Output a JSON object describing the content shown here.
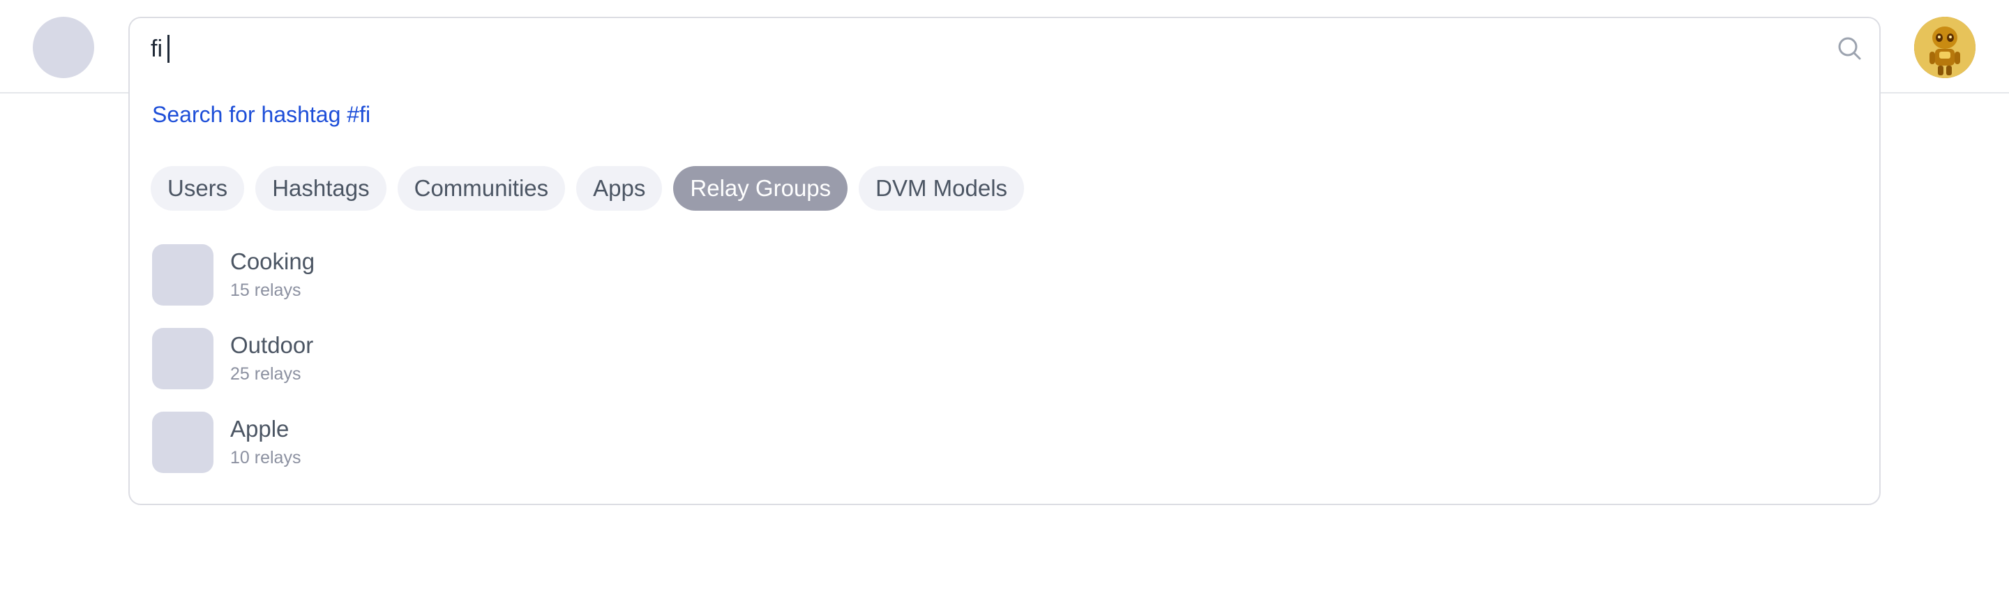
{
  "search": {
    "value": "fi",
    "placeholder": ""
  },
  "suggestion": {
    "hashtag_link": "Search for hashtag #fi"
  },
  "tabs": [
    {
      "label": "Users",
      "active": false
    },
    {
      "label": "Hashtags",
      "active": false
    },
    {
      "label": "Communities",
      "active": false
    },
    {
      "label": "Apps",
      "active": false
    },
    {
      "label": "Relay Groups",
      "active": true
    },
    {
      "label": "DVM Models",
      "active": false
    }
  ],
  "results": [
    {
      "name": "Cooking",
      "subtitle": "15 relays"
    },
    {
      "name": "Outdoor",
      "subtitle": "25 relays"
    },
    {
      "name": "Apple",
      "subtitle": "10 relays"
    }
  ],
  "colors": {
    "link": "#1d4ed8",
    "tab_active_bg": "#9a9cab",
    "tab_bg": "#f1f2f7",
    "placeholder_bg": "#d7d9e6"
  },
  "icons": {
    "search": "search-icon",
    "avatar": "user-avatar"
  }
}
